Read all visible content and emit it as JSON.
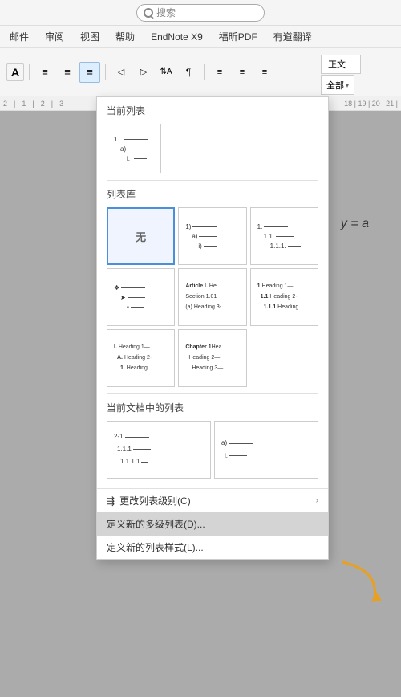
{
  "titlebar": {
    "search_placeholder": "搜索"
  },
  "menubar": {
    "items": [
      "邮件",
      "审阅",
      "视图",
      "帮助",
      "EndNote X9",
      "福昕PDF",
      "有道翻译"
    ]
  },
  "toolbar": {
    "style_label": "正文",
    "filter_label": "全部",
    "filter_arrow": "▾"
  },
  "dropdown": {
    "section_current": "当前列表",
    "section_library": "列表库",
    "section_document": "当前文档中的列表",
    "none_label": "无",
    "library_items": [
      {
        "id": "none",
        "label": "无"
      },
      {
        "id": "numbered1",
        "type": "numbered-paren"
      },
      {
        "id": "numbered2",
        "type": "numbered-dot"
      },
      {
        "id": "symbols",
        "type": "symbols"
      },
      {
        "id": "article",
        "type": "article-section"
      },
      {
        "id": "heading1",
        "type": "heading1"
      },
      {
        "id": "roman-heading",
        "type": "roman-heading"
      },
      {
        "id": "chapter",
        "type": "chapter"
      }
    ],
    "bottom_items": [
      {
        "id": "change-level",
        "label": "更改列表级别(C)",
        "has_arrow": true
      },
      {
        "id": "define-new",
        "label": "定义新的多级列表(D)...",
        "highlighted": true
      },
      {
        "id": "define-style",
        "label": "定义新的列表样式(L)..."
      }
    ]
  },
  "equation": "y = a",
  "arrow_color": "#e8a020"
}
